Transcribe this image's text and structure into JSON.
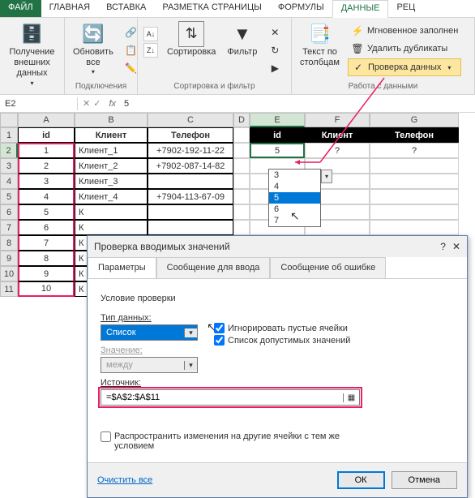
{
  "ribbon_tabs": {
    "file": "ФАЙЛ",
    "home": "ГЛАВНАЯ",
    "insert": "ВСТАВКА",
    "page_layout": "РАЗМЕТКА СТРАНИЦЫ",
    "formulas": "ФОРМУЛЫ",
    "data": "ДАННЫЕ",
    "review": "РЕЦ"
  },
  "ribbon": {
    "get_data": "Получение\nвнешних данных",
    "refresh": "Обновить\nвсе",
    "connections_label": "Подключения",
    "sort": "Сортировка",
    "filter": "Фильтр",
    "sort_filter_label": "Сортировка и фильтр",
    "text_to_cols": "Текст по\nстолбцам",
    "flash_fill": "Мгновенное заполнен",
    "remove_dupes": "Удалить дубликаты",
    "data_validation": "Проверка данных",
    "data_tools_label": "Работа с данными"
  },
  "formula_bar": {
    "name_box": "E2",
    "value": "5"
  },
  "columns": [
    "A",
    "B",
    "C",
    "D",
    "E",
    "F",
    "G"
  ],
  "rows": [
    "1",
    "2",
    "3",
    "4",
    "5",
    "6",
    "7",
    "8",
    "9",
    "10",
    "11"
  ],
  "table1": {
    "headers": {
      "id": "id",
      "client": "Клиент",
      "phone": "Телефон"
    },
    "rows": [
      {
        "id": "1",
        "client": "Клиент_1",
        "phone": "+7902-192-11-22"
      },
      {
        "id": "2",
        "client": "Клиент_2",
        "phone": "+7902-087-14-82"
      },
      {
        "id": "3",
        "client": "Клиент_3",
        "phone": ""
      },
      {
        "id": "4",
        "client": "Клиент_4",
        "phone": "+7904-113-67-09"
      },
      {
        "id": "5",
        "client": "К",
        "phone": ""
      },
      {
        "id": "6",
        "client": "К",
        "phone": ""
      },
      {
        "id": "7",
        "client": "К",
        "phone": ""
      },
      {
        "id": "8",
        "client": "К",
        "phone": ""
      },
      {
        "id": "9",
        "client": "К",
        "phone": ""
      },
      {
        "id": "10",
        "client": "К",
        "phone": ""
      }
    ]
  },
  "table2": {
    "headers": {
      "id": "id",
      "client": "Клиент",
      "phone": "Телефон"
    },
    "row": {
      "id": "5",
      "client": "?",
      "phone": "?"
    }
  },
  "dropdown": {
    "items": [
      "3",
      "4",
      "5",
      "6",
      "7"
    ],
    "selected": "5"
  },
  "dialog": {
    "title": "Проверка вводимых значений",
    "tabs": {
      "params": "Параметры",
      "input_msg": "Сообщение для ввода",
      "error_msg": "Сообщение об ошибке"
    },
    "section": "Условие проверки",
    "type_label": "Тип данных:",
    "type_value": "Список",
    "ignore_empty": "Игнорировать пустые ячейки",
    "allow_list": "Список допустимых значений",
    "value_label": "Значение:",
    "value_value": "между",
    "source_label": "Источник:",
    "source_value": "=$A$2:$A$11",
    "propagate": "Распространить изменения на другие ячейки с тем же условием",
    "clear_all": "Очистить все",
    "ok": "ОК",
    "cancel": "Отмена"
  }
}
